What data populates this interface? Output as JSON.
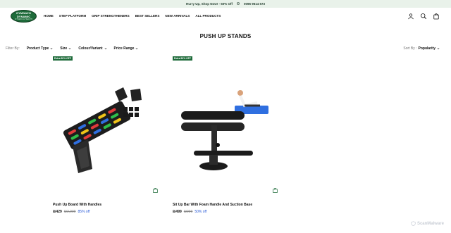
{
  "announcement": {
    "promo": "Hurry Up, Shop Now! - 50% Off",
    "phone_icon": "phone-icon",
    "phone": "0096 9614 573"
  },
  "logo": {
    "line1": "GYMNAZO",
    "line2": "DYNAMIC",
    "line3": "FITNESS & HEALTH"
  },
  "nav": [
    "HOME",
    "STEP PLATFORM",
    "GRIP STRENGTHENERS",
    "BEST SELLERS",
    "NEW ARRIVALS",
    "ALL PRODUCTS"
  ],
  "header_icons": [
    "user-icon",
    "search-icon",
    "bag-icon"
  ],
  "page_title": "PUSH UP STANDS",
  "filters": {
    "label": "Filter By:",
    "items": [
      "Product Type",
      "Size",
      "Colour/Variant",
      "Price Range"
    ]
  },
  "sort": {
    "label": "Sort By :",
    "value": "Popularity"
  },
  "products": [
    {
      "badge": "Extra 50% OFF",
      "name": "Push Up Board With Handles",
      "price": "₪429",
      "compare": "₪2,999",
      "discount": "85% off"
    },
    {
      "badge": "Extra 50% OFF",
      "name": "Sit Up Bar With Foam Handle And Suction Base",
      "price": "₪499",
      "compare": "₪999",
      "discount": "50% off"
    }
  ],
  "watermark": "ScanMalware",
  "colors": {
    "brand": "#1e6b3a",
    "announce_bg": "#e9f2ea",
    "discount": "#2a5bd7"
  }
}
